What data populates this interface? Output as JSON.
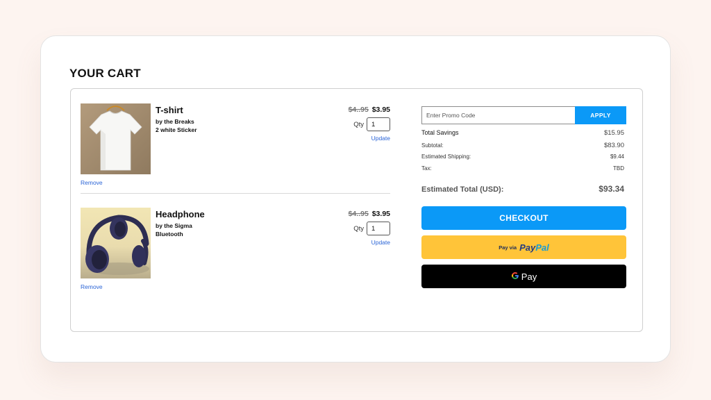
{
  "page": {
    "title": "YOUR CART"
  },
  "cart": {
    "items": [
      {
        "name": "T-shirt",
        "desc_line1": "by the Breaks",
        "desc_line2": "2 white Sticker",
        "price_old": "$4..95",
        "price_new": "$3.95",
        "qty_label": "Qty",
        "qty_value": "1",
        "update_label": "Update",
        "remove_label": "Remove"
      },
      {
        "name": "Headphone",
        "desc_line1": "by the Sigma",
        "desc_line2": "Bluetooth",
        "price_old": "$4..95",
        "price_new": "$3.95",
        "qty_label": "Qty",
        "qty_value": "1",
        "update_label": "Update",
        "remove_label": "Remove"
      }
    ]
  },
  "summary": {
    "promo_placeholder": "Enter Promo Code",
    "apply_label": "APPLY",
    "total_savings_label": "Total Savings",
    "total_savings_value": "$15.95",
    "subtotal_label": "Subtotal:",
    "subtotal_value": "$83.90",
    "shipping_label": "Estimated Shipping:",
    "shipping_value": "$9.44",
    "tax_label": "Tax:",
    "tax_value": "TBD",
    "total_label": "Estimated Total (USD):",
    "total_value": "$93.34",
    "checkout_label": "CHECKOUT",
    "paypal_prefix": "Pay via",
    "paypal_pay": "Pay",
    "paypal_pal": "Pal",
    "gpay_label": "Pay"
  },
  "colors": {
    "accent": "#0b99f7",
    "link": "#2a64d6",
    "paypal_bg": "#ffc439",
    "gpay_bg": "#000000",
    "page_bg": "#fdf4f0"
  },
  "icons": {
    "tshirt_image": "tshirt-product-photo",
    "headphone_image": "headphone-product-photo",
    "google_g": "google-g-icon"
  }
}
